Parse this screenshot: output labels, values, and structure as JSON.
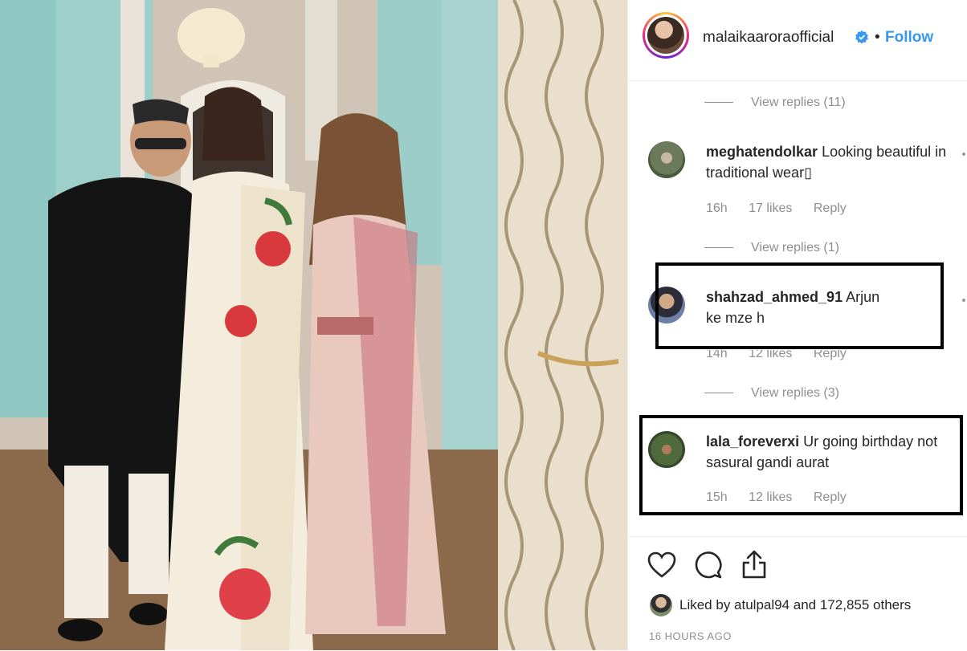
{
  "post": {
    "username": "malaikaaroraofficial",
    "separator": "•",
    "follow_label": "Follow"
  },
  "comments": [
    {
      "view_replies": "View replies (11)"
    },
    {
      "username": "meghatendolkar",
      "text": "Looking beautiful in traditional wear▯",
      "time": "16h",
      "likes": "17 likes",
      "reply": "Reply",
      "view_replies": "View replies (1)"
    },
    {
      "username": "shahzad_ahmed_91",
      "text": "Arjun ke mze h",
      "time": "14h",
      "likes": "12 likes",
      "reply": "Reply",
      "view_replies": "View replies (3)"
    },
    {
      "username": "lala_foreverxi",
      "text": "Ur going birthday not sasural gandi aurat",
      "time": "15h",
      "likes": "12 likes",
      "reply": "Reply"
    }
  ],
  "footer": {
    "liked_by": "Liked by atulpal94 and 172,855 others",
    "timestamp": "16 HOURS AGO"
  },
  "icons": [
    "heart-icon",
    "comment-icon",
    "share-icon",
    "verified-icon"
  ],
  "colors": {
    "accent": "#3897f0",
    "text": "#262626",
    "muted": "#8e8e8e"
  }
}
